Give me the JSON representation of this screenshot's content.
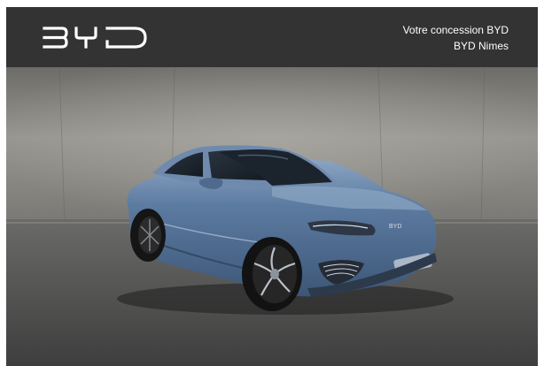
{
  "header": {
    "brand_logo": "BYD",
    "dealer_line1": "Votre concession BYD",
    "dealer_line2": "BYD Nimes"
  },
  "hero": {
    "image": "blue-byd-seal-sedan-photo",
    "car_badge": "BYD"
  },
  "colors": {
    "header_bg": "#333333",
    "car_body": "#4f6c90",
    "wall": "#8a8a86",
    "floor": "#4a4a4a"
  }
}
